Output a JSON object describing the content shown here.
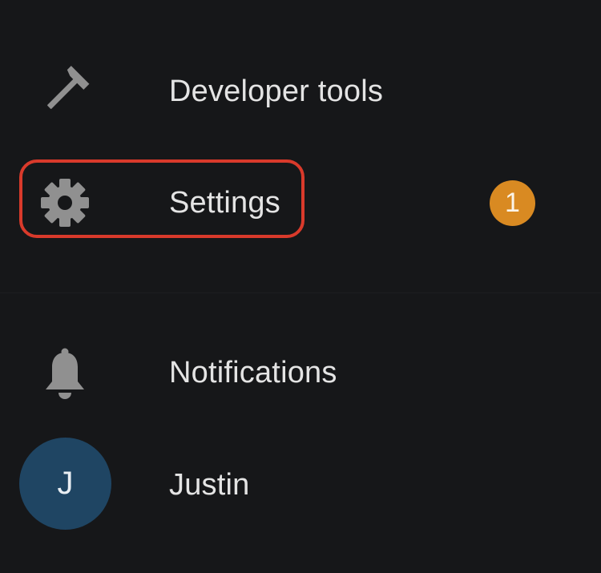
{
  "menu": {
    "items": [
      {
        "label": "Developer tools",
        "icon": "hammer-icon"
      },
      {
        "label": "Settings",
        "icon": "gear-icon",
        "badge": "1",
        "highlighted": true
      },
      {
        "label": "Notifications",
        "icon": "bell-icon"
      }
    ]
  },
  "user": {
    "initial": "J",
    "name": "Justin"
  },
  "colors": {
    "background": "#161719",
    "text": "#e4e4e4",
    "icon": "#909090",
    "highlight_border": "#d93a2b",
    "badge": "#d98a22",
    "avatar": "#1f4563"
  }
}
